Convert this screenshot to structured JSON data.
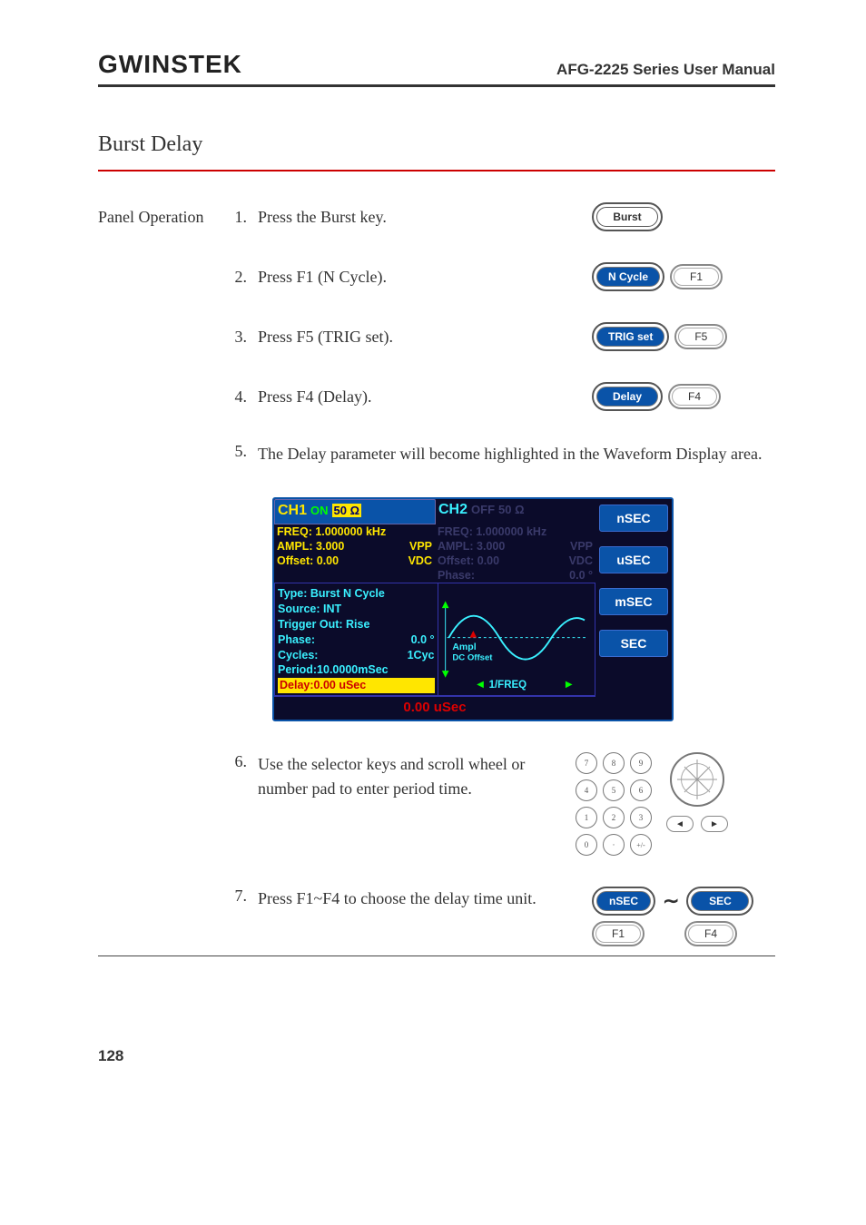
{
  "header": {
    "brand": "GWINSTEK",
    "title": "AFG-2225 Series User Manual"
  },
  "section": "Burst Delay",
  "panel_label": "Panel Operation",
  "steps": [
    {
      "n": "1.",
      "text": "Press the Burst key."
    },
    {
      "n": "2.",
      "text": "Press F1 (N Cycle)."
    },
    {
      "n": "3.",
      "text": "Press F5 (TRIG set)."
    },
    {
      "n": "4.",
      "text": "Press F4 (Delay)."
    },
    {
      "n": "5.",
      "text": "The Delay parameter will become highlighted in the Waveform Display area."
    },
    {
      "n": "6.",
      "text": "Use the selector keys and scroll wheel or number pad to enter period time."
    },
    {
      "n": "7.",
      "text": "Press F1~F4 to choose the delay time unit."
    }
  ],
  "buttons": {
    "burst": "Burst",
    "ncycle": "N Cycle",
    "trigset": "TRIG set",
    "delay": "Delay",
    "f1": "F1",
    "f4": "F4",
    "f5": "F5",
    "nsec_label": "nSEC",
    "sec_label": "SEC"
  },
  "lcd": {
    "ch1": {
      "name": "CH1",
      "state": "ON",
      "imp": "50 Ω"
    },
    "ch2": {
      "name": "CH2",
      "state": "OFF",
      "imp": "50 Ω"
    },
    "ch1_info": {
      "freq": "FREQ: 1.000000 kHz",
      "ampl_l": "AMPL:  3.000",
      "ampl_r": "VPP",
      "off_l": "Offset:   0.00",
      "off_r": "VDC"
    },
    "ch2_info": {
      "freq": "FREQ: 1.000000 kHz",
      "ampl_l": "AMPL:  3.000",
      "ampl_r": "VPP",
      "off_l": "Offset:   0.00",
      "off_r": "VDC",
      "phase_l": "Phase:",
      "phase_r": "0.0 °"
    },
    "burst": {
      "type": "Type: Burst N Cycle",
      "source": "Source: INT",
      "trigout": "Trigger Out: Rise",
      "phase_l": "Phase:",
      "phase_r": "0.0 °",
      "cycles_l": "Cycles:",
      "cycles_r": "1Cyc",
      "period": "Period:10.0000mSec",
      "delay": "Delay:0.00      uSec"
    },
    "graph": {
      "ampl": "Ampl",
      "dco": "DC Offset",
      "freq": "1/FREQ"
    },
    "value": "0.00 uSec",
    "soft": [
      "nSEC",
      "uSEC",
      "mSEC",
      "SEC"
    ]
  },
  "numpad": [
    "7",
    "8",
    "9",
    "4",
    "5",
    "6",
    "1",
    "2",
    "3",
    "0",
    "·",
    "+/-"
  ],
  "page": "128"
}
